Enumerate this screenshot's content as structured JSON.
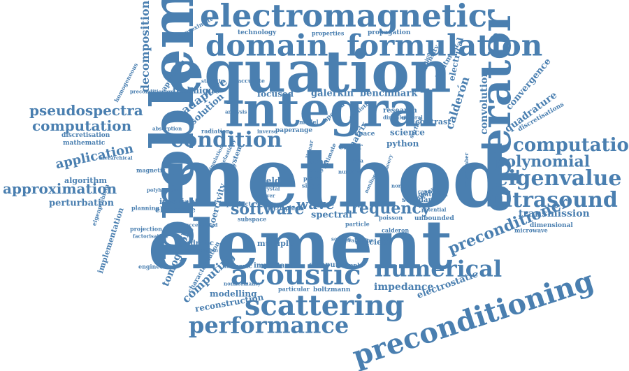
{
  "colors": {
    "word": "#4a7fb0",
    "background": "#ffffff"
  },
  "words": [
    "method",
    "element",
    "problem",
    "equation",
    "integral",
    "operator",
    "electromagnetic",
    "domain",
    "formulation",
    "preconditioning",
    "scattering",
    "acoustic",
    "numerical",
    "performance",
    "condition",
    "computational",
    "ultrasound",
    "eigenvalue",
    "polynomial",
    "preconditioner",
    "software",
    "frequency",
    "wave",
    "approximation",
    "computation",
    "pseudospectra",
    "application",
    "decomposition",
    "convolution",
    "calderón",
    "quadrature",
    "convergence",
    "transmission",
    "impedance",
    "electrostatic",
    "tomography",
    "computing",
    "modelling",
    "reconstruction",
    "galerkin",
    "benchmark",
    "focused",
    "technique",
    "adaptive",
    "solution",
    "perturbation",
    "algorithm",
    "implementation",
    "electrode",
    "invariant",
    "spectral",
    "multiple",
    "efficient",
    "important",
    "computer",
    "harmonic",
    "boltzmann",
    "particular",
    "coercivity",
    "quadratic",
    "projection",
    "planning",
    "engineering",
    "mathematic",
    "discretisation",
    "discretisations",
    "dimensional",
    "microwave",
    "science",
    "python",
    "contrast",
    "research",
    "matrix",
    "error",
    "field",
    "time",
    "space",
    "paper",
    "range",
    "technology",
    "properties",
    "propagation",
    "approximate",
    "homogeneous",
    "preconditioners",
    "approach",
    "characterisation",
    "treatment",
    "electrical",
    "intensity",
    "standard",
    "material",
    "complex",
    "unbounded",
    "capacity",
    "potential",
    "solver",
    "crystal",
    "single",
    "plane",
    "surface",
    "number",
    "example",
    "linear",
    "inverse",
    "model",
    "particle",
    "poisson",
    "calderon",
    "radiation",
    "absorption",
    "accelerated",
    "factorisation",
    "hierarchical",
    "magnetic",
    "polyhedron",
    "eigenproblem",
    "linearization",
    "simulation",
    "nonnormality",
    "solving",
    "spectra",
    "realistic",
    "accurate",
    "dirichlet",
    "general",
    "evaluation",
    "subspace",
    "laplace",
    "electric",
    "product",
    "system",
    "code",
    "estimate",
    "theory",
    "normal",
    "nonlinear",
    "analysis",
    "stability",
    "wavenumber",
    "differentiation",
    "elasticity",
    "media"
  ]
}
